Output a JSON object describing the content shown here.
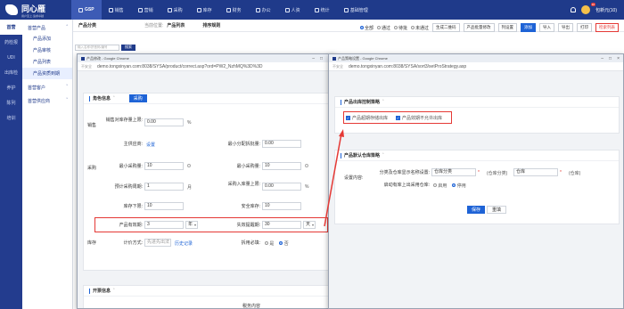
{
  "app": {
    "name": "同心雁",
    "tagline": "用户至上·追求卓越"
  },
  "topnav": [
    {
      "label": "GSP",
      "icon": "home-icon"
    },
    {
      "label": "销售",
      "icon": "cart-icon"
    },
    {
      "label": "营销",
      "icon": "megaphone-icon"
    },
    {
      "label": "采购",
      "icon": "truck-icon"
    },
    {
      "label": "库存",
      "icon": "box-icon"
    },
    {
      "label": "财务",
      "icon": "money-icon"
    },
    {
      "label": "办公",
      "icon": "briefcase-icon"
    },
    {
      "label": "人资",
      "icon": "people-icon"
    },
    {
      "label": "统计",
      "icon": "chart-icon"
    },
    {
      "label": "基础管理",
      "icon": "gear-icon"
    }
  ],
  "user": {
    "name": "包新元",
    "badge": "10",
    "notify": "包新元(10)"
  },
  "sidebar": [
    "首营",
    "药检报",
    "UDI",
    "出库检",
    "养护",
    "陈列",
    "培训"
  ],
  "submenu": {
    "group1": "首营产品",
    "items": [
      "产品添加",
      "产品审核",
      "产品列表",
      "产品资质到期"
    ],
    "group2": "首营客户",
    "group3": "首营供应商"
  },
  "bg_page": {
    "section": "产品分类",
    "breadcrumb": "当前位置:",
    "list_title": "产品列表",
    "sort": "排序规则",
    "search_placeholder": "输入名称/拼音码/编号",
    "search_btn": "搜索",
    "filters": [
      "全部",
      "通过",
      "待批",
      "未通过"
    ],
    "buttons": [
      "生成二维码",
      "产品批量修改",
      "列设置",
      "添加",
      "导入",
      "导出",
      "打印",
      "检索列表"
    ]
  },
  "win1": {
    "title": "产品修改 - Google Chrome",
    "security": "不安全",
    "url": "demo.tongxinyan.com:8038/SYSA/product/correct.asp?ord=PW2_NzhMQ%3D%3D",
    "card_title": "角色信息",
    "card_btn": "采购",
    "sections": {
      "sales": "销售",
      "purchase": "采购",
      "stock": "库存"
    },
    "fields": {
      "sales_limit_label": "销售对库存量上限:",
      "sales_limit_value": "0.00",
      "sales_limit_unit": "%",
      "supplier_label": "主供应商:",
      "supplier_link": "设置",
      "min_split_label": "最小分配拆批量:",
      "min_split_value": "0.00",
      "min_buy_label": "最小采购量:",
      "min_buy_value": "10",
      "min_stock_label": "最小采购量:",
      "min_stock_value": "10",
      "cycle_label": "预计采购周期:",
      "cycle_value": "1",
      "cycle_unit": "月",
      "in_limit_label": "采购入库量上限:",
      "in_limit_value": "0.00",
      "in_limit_unit": "%",
      "stock_low_label": "库存下限:",
      "stock_low_value": "10",
      "safe_label": "安全库存:",
      "safe_value": "10",
      "shelf_label": "产品有效期:",
      "shelf_value": "3",
      "shelf_unit": "年",
      "warn_label": "失效提醒期:",
      "warn_value": "30",
      "warn_unit": "天",
      "price_label": "计价方式:",
      "price_value": "先进先出法",
      "history_link": "历史记录",
      "split_label": "拆用必填:",
      "split_opts": [
        "是",
        "否"
      ]
    },
    "card2_title": "开票信息",
    "card2_field": "税务内容"
  },
  "win2": {
    "title": "产品策略设置 - Google Chrome",
    "security": "不安全",
    "url": "demo.tongxinyan.com:8038/SYSA/sort3/setProStrategy.asp",
    "card1_title": "产品出库控制策略",
    "check1": "产品超期存储出库",
    "check2": "产品效期不允许出库",
    "card2_title": "产品默认仓库策略",
    "setting_label": "设置内容:",
    "line1_label": "分类及仓库显示名称设置:",
    "cat_value": "仓库分类",
    "warehouse_value": "仓库",
    "cat_hint": "(仓库分类)",
    "wh_hint": "(仓库)",
    "line2_label": "启动有库上出采用仓库:",
    "enable_opts": [
      "启用",
      "停用"
    ],
    "save_btn": "保存",
    "reset_btn": "重填"
  },
  "colors": {
    "nav": "#1f3a8a",
    "accent": "#1e63d6",
    "highlight": "#e53935"
  }
}
